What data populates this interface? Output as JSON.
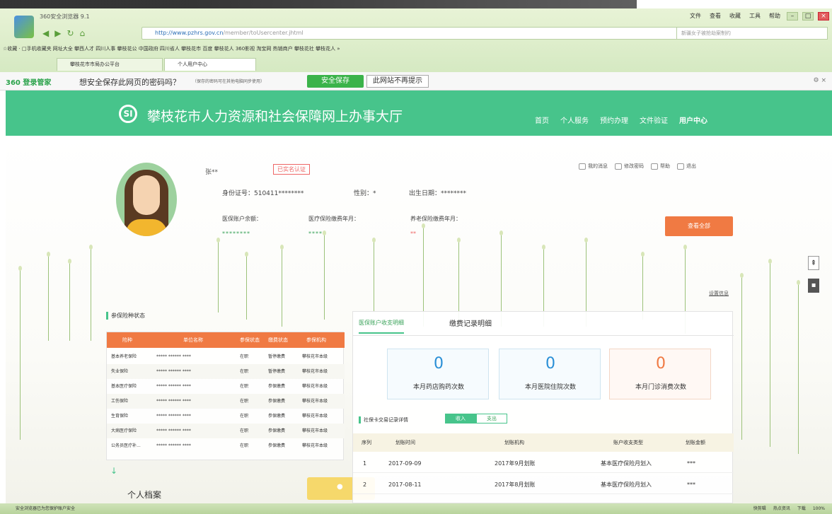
{
  "browser": {
    "app_title": "360安全浏览器 9.1",
    "menu": [
      "文件",
      "查看",
      "收藏",
      "工具",
      "帮助"
    ],
    "url_host": "http://www.pzhrs.gov.cn",
    "url_path": "/member/toUsercenter.jhtml",
    "search_placeholder": "新疆女子被抢劫案制约",
    "bookmarks": "☆收藏 · □手机收藏夹  网址大全  攀西人才  四川人事  攀枝花公  中国政府  四川省人  攀枝花市  百度  攀枝花人  360影视  淘宝网  热销商户  攀枝花社  攀枝花人  »",
    "tabs": [
      "攀枝花市市局办公平台",
      "个人用户中心"
    ]
  },
  "notice_bar": {
    "brand": "360 登录管家",
    "question": "想安全保存此网页的密码吗？",
    "sub": "（保存的密码可在其他电脑同步使用）",
    "save_label": "安全保存",
    "never_label": "此网站不再提示"
  },
  "site": {
    "logo_text": "SI",
    "title": "攀枝花市人力资源和社会保障网上办事大厅",
    "nav": [
      "首页",
      "个人服务",
      "预约办理",
      "文件验证",
      "用户中心"
    ]
  },
  "user": {
    "name": "张**",
    "verified": "已实名认证",
    "id_label": "身份证号：510411********",
    "gender_label": "性别：*",
    "birth_label": "出生日期：********",
    "acc_labels": [
      "医保账户余额：",
      "医疗保险缴费年月：",
      "养老保险缴费年月："
    ],
    "acc_values": [
      "********",
      "****",
      "**"
    ],
    "actions": [
      "我的消息",
      "修改密码",
      "帮助",
      "退出"
    ],
    "view_btn": "查看全部"
  },
  "right_link": "设置信息",
  "insurance": {
    "title": "参保险种状态",
    "headers": [
      "险种",
      "单位名称",
      "参保状态",
      "缴费状态",
      "参保机构"
    ],
    "rows": [
      [
        "基本养老保险",
        "***** ****** ****",
        "在职",
        "暂停缴费",
        "攀枝花市本级"
      ],
      [
        "失业保险",
        "***** ****** ****",
        "在职",
        "暂停缴费",
        "攀枝花市本级"
      ],
      [
        "基本医疗保险",
        "***** ****** ****",
        "在职",
        "参保缴费",
        "攀枝花市本级"
      ],
      [
        "工伤保险",
        "***** ****** ****",
        "在职",
        "参保缴费",
        "攀枝花市本级"
      ],
      [
        "生育保险",
        "***** ****** ****",
        "在职",
        "参保缴费",
        "攀枝花市本级"
      ],
      [
        "大病医疗保险",
        "***** ****** ****",
        "在职",
        "参保缴费",
        "攀枝花市本级"
      ],
      [
        "公务员医疗补...",
        "***** ****** ****",
        "在职",
        "参保缴费",
        "攀枝花市本级"
      ]
    ]
  },
  "personal_file": "个人档案",
  "records": {
    "tab1": "医保账户收支明细",
    "tab2": "缴费记录明细",
    "stats": [
      {
        "value": "0",
        "label": "本月药店购药次数"
      },
      {
        "value": "0",
        "label": "本月医院住院次数"
      },
      {
        "value": "0",
        "label": "本月门诊消费次数"
      }
    ],
    "tx_title": "社保卡交易记录详情",
    "btn_in": "收入",
    "btn_out": "支出",
    "headers": [
      "序列",
      "划账时间",
      "划账机构",
      "账户收支类型",
      "划账金额"
    ],
    "rows": [
      [
        "1",
        "2017-09-09",
        "2017年9月划账",
        "基本医疗保险月划入",
        "***"
      ],
      [
        "2",
        "2017-08-11",
        "2017年8月划账",
        "基本医疗保险月划入",
        "***"
      ]
    ]
  },
  "statusbar": {
    "left": "安全浏览器已为您保护账户安全",
    "right": [
      "快剪辑",
      "热点资讯",
      "下载",
      "100%"
    ]
  }
}
